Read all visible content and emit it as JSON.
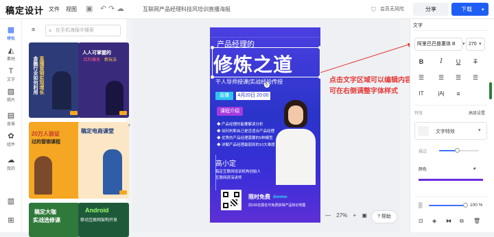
{
  "app": {
    "name": "稿定设计",
    "menus": [
      "文件",
      "视图"
    ],
    "doc_title": "互联网产品经理科技风培训直播海报",
    "vip": "会员无风险",
    "share": "分享",
    "download": "下载"
  },
  "rail": [
    {
      "label": "模板",
      "icon": "template-icon",
      "active": true
    },
    {
      "label": "素材",
      "icon": "shapes-icon"
    },
    {
      "label": "文字",
      "icon": "text-icon"
    },
    {
      "label": "照片",
      "icon": "photo-icon"
    },
    {
      "label": "背景",
      "icon": "background-icon"
    },
    {
      "label": "组件",
      "icon": "component-icon"
    },
    {
      "label": "我的",
      "icon": "cloud-user-icon"
    }
  ],
  "panel": {
    "search_placeholder": "在手机海报中搜索",
    "thumbs": [
      {
        "text": [
          "金融行业如何利用",
          "直播营销实现增长"
        ],
        "bg": "#2d3c78"
      },
      {
        "text": [
          "人人可掌握的",
          "红利爆发",
          "新玩法"
        ],
        "bg": "#3a2a7c"
      },
      {
        "text": [
          "20万人验证",
          "过的营销课程"
        ],
        "bg": "#f5a623"
      },
      {
        "text": [
          "稿定电商课堂"
        ],
        "bg": "#fbe7c6"
      },
      {
        "text": [
          "稿定大咖",
          "实战选修课"
        ],
        "bg": "#2f7a3a"
      },
      {
        "text": [
          "Android",
          "移动互联网架构开发"
        ],
        "bg": "#1e5a3a"
      }
    ]
  },
  "poster": {
    "line1": "产品经理的",
    "headline": "修炼之道",
    "subline": "干人导师授课|实战经验传授",
    "live_tag": "直播",
    "date": "4月20日 20:00",
    "intro_title": "课程介绍",
    "bullets": [
      "产品经理的能要解读分析",
      "如何判断自己是否适合产品经理",
      "优秀的产品经理需要的5种模型",
      "详解产品经理最弱到的10大难题"
    ],
    "name": "高小定",
    "bio": [
      "稿定互联网培训机构创始人",
      "互联网资深讲师"
    ],
    "free": "限时免费",
    "free_note": "原价99元",
    "limit": "前100名报名可免费获得产品知识地图"
  },
  "annotation": {
    "line1": "点击文字区域可以编辑内容",
    "line2": "可在右侧调整字体样式"
  },
  "zoom": {
    "value": "27%",
    "minus": "—",
    "plus": "+"
  },
  "help": "? 帮助",
  "props": {
    "title": "文字",
    "font": "阿里巴巴普惠体 B",
    "size": "270",
    "effects_label": "特效",
    "advanced": "高级设置",
    "effect_select": "文字特效",
    "stroke_label": "描边",
    "color_label": "颜色",
    "opacity": "100 %"
  },
  "colors": {
    "accent": "#1f5ef5",
    "annotation": "#e53935",
    "poster_top": "#4b3fe0"
  }
}
